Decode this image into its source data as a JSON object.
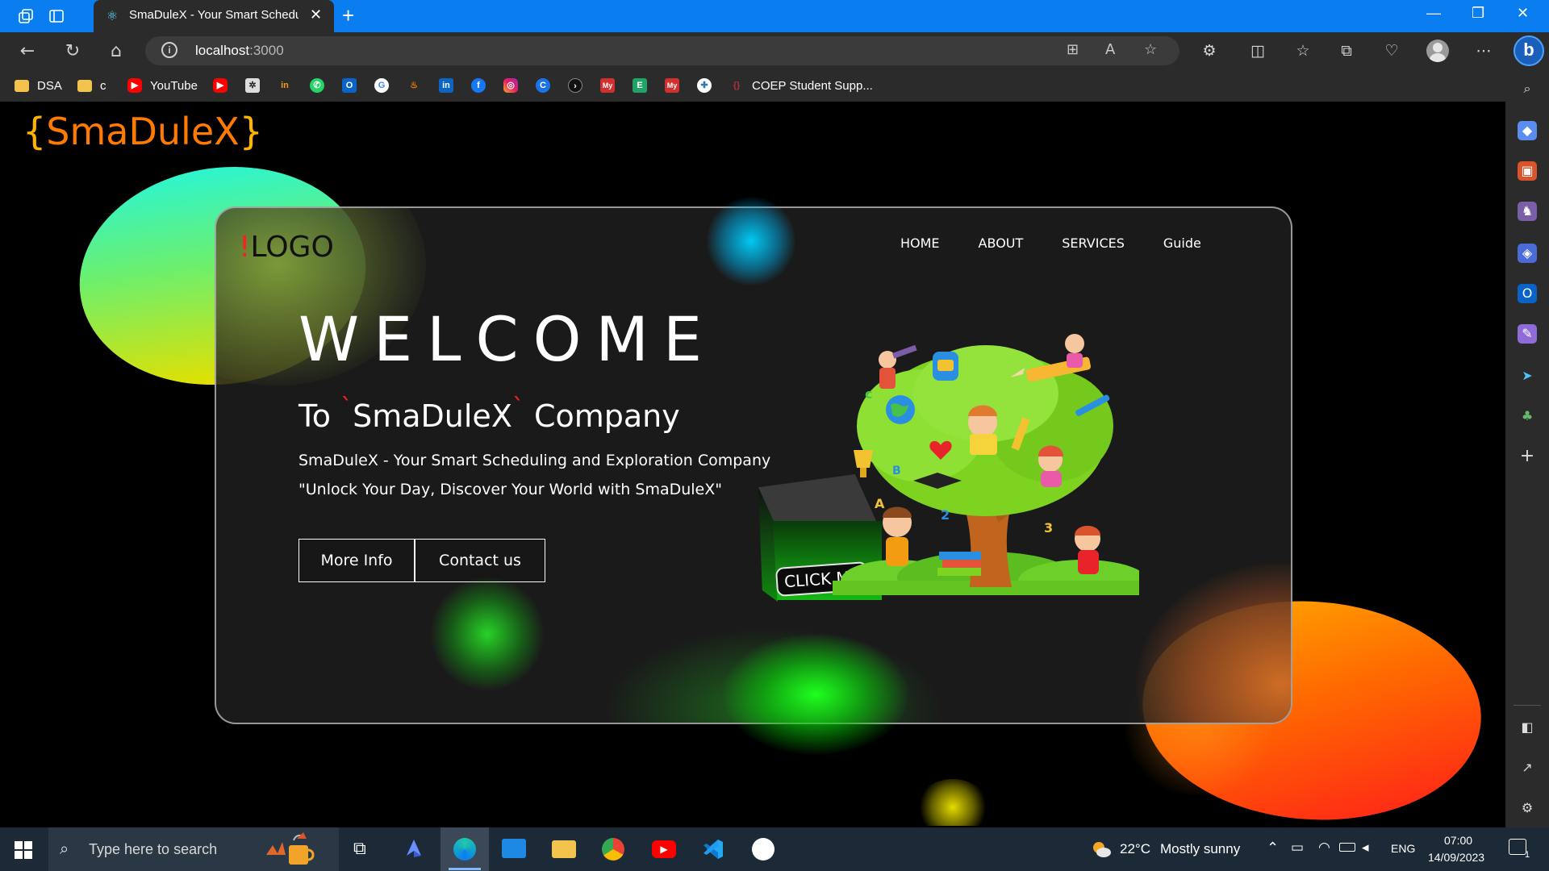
{
  "browser": {
    "tab_title": "SmaDuleX - Your Smart Scheduli",
    "url_host": "localhost",
    "url_port": ":3000",
    "new_tab": "+",
    "close_tab": "✕"
  },
  "bookmarks": [
    {
      "label": "DSA",
      "icon": "folder-icon"
    },
    {
      "label": "c",
      "icon": "folder-icon"
    },
    {
      "label": "YouTube",
      "icon": "youtube-icon"
    },
    {
      "label": "COEP Student Supp...",
      "icon": "coep-icon"
    }
  ],
  "page": {
    "brand_open": "{",
    "brand_name": "SmaDuleX",
    "brand_close": "}",
    "logo_bang": "!",
    "logo_text": "LOGO",
    "nav": [
      "HOME",
      "ABOUT",
      "SERVICES",
      "Guide"
    ],
    "welcome": "WELCOME",
    "line_to": "To",
    "line_name": "SmaDuleX",
    "line_company": "Company",
    "tick": "`",
    "tagline1": "SmaDuleX - Your Smart Scheduling and Exploration Company",
    "tagline2": "\"Unlock Your Day, Discover Your World with SmaDuleX\"",
    "btn_more": "More Info",
    "btn_contact": "Contact us",
    "cube_label": "CLICK ME"
  },
  "taskbar": {
    "search_placeholder": "Type here to search",
    "weather_temp": "22°C",
    "weather_desc": "Mostly sunny",
    "lang": "ENG",
    "time": "07:00",
    "date": "14/09/2023",
    "notif_count": "1"
  },
  "colors": {
    "titlebar": "#0a7ef0",
    "brand_orange": "#ff7a00",
    "logo_red": "#ff1e1e",
    "card_bg": "#1e1e1e",
    "taskbar": "#1c2a38"
  }
}
